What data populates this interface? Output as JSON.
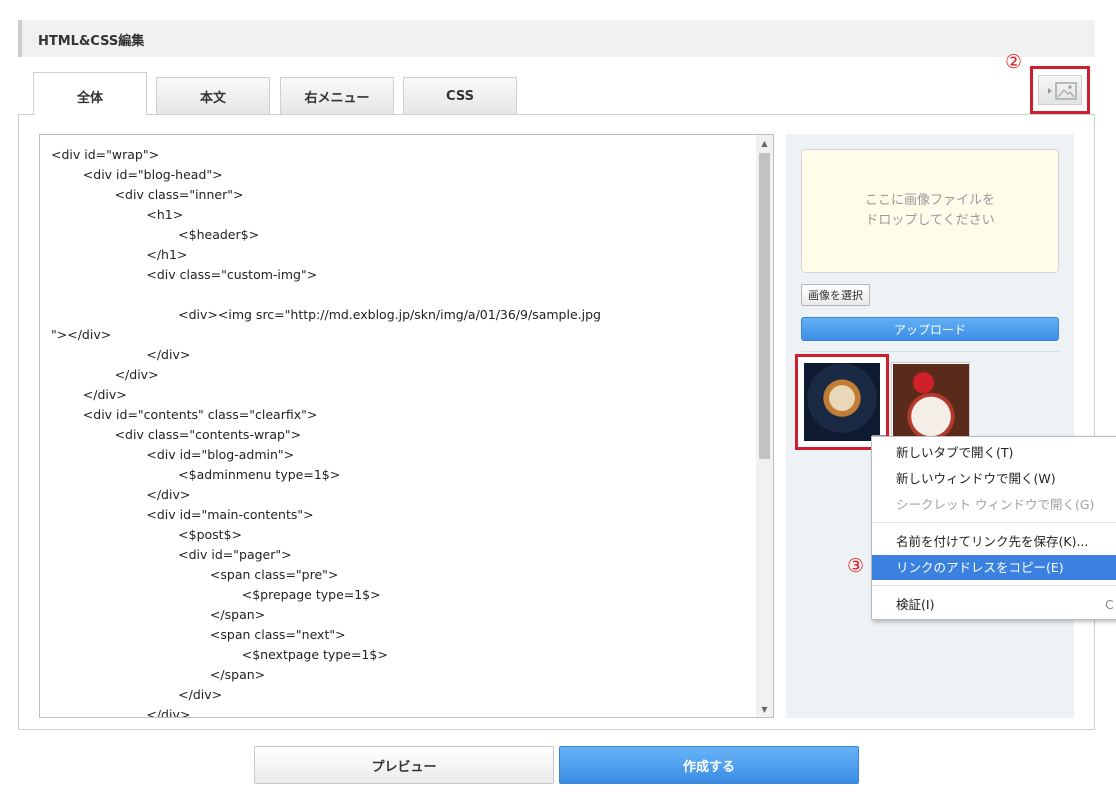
{
  "header": {
    "title": "HTML&CSS編集"
  },
  "tabs": [
    {
      "label": "全体",
      "active": true
    },
    {
      "label": "本文",
      "active": false
    },
    {
      "label": "右メニュー",
      "active": false
    },
    {
      "label": "CSS",
      "active": false
    }
  ],
  "markers": {
    "two": "②",
    "three": "③"
  },
  "accent_color": "#d01f2c",
  "highlight_color": "#3b82e0",
  "editor": {
    "lines": [
      "<div id=\"wrap\">",
      "        <div id=\"blog-head\">",
      "                <div class=\"inner\">",
      "                        <h1>",
      "                                <$header$>",
      "                        </h1>",
      "                        <div class=\"custom-img\">",
      "",
      "                                <div><img src=\"http://md.exblog.jp/skn/img/a/01/36/9/sample.jpg",
      "\"></div>",
      "                        </div>",
      "                </div>",
      "        </div>",
      "        <div id=\"contents\" class=\"clearfix\">",
      "                <div class=\"contents-wrap\">",
      "                        <div id=\"blog-admin\">",
      "                                <$adminmenu type=1$>",
      "                        </div>",
      "                        <div id=\"main-contents\">",
      "                                <$post$>",
      "                                <div id=\"pager\">",
      "                                        <span class=\"pre\">",
      "                                                <$prepage type=1$>",
      "                                        </span>",
      "                                        <span class=\"next\">",
      "                                                <$nextpage type=1$>",
      "                                        </span>",
      "                                </div>",
      "                        </div>"
    ]
  },
  "uploader": {
    "drop_line1": "ここに画像ファイルを",
    "drop_line2": "ドロップしてください",
    "select_label": "画像を選択",
    "upload_label": "アップロード"
  },
  "context_menu": {
    "items": [
      "新しいタブで開く(T)",
      "新しいウィンドウで開く(W)",
      "シークレット ウィンドウで開く(G)",
      "名前を付けてリンク先を保存(K)...",
      "リンクのアドレスをコピー(E)",
      "検証(I)"
    ],
    "shortcut_fragment": "C"
  },
  "footer": {
    "preview_label": "プレビュー",
    "create_label": "作成する"
  }
}
